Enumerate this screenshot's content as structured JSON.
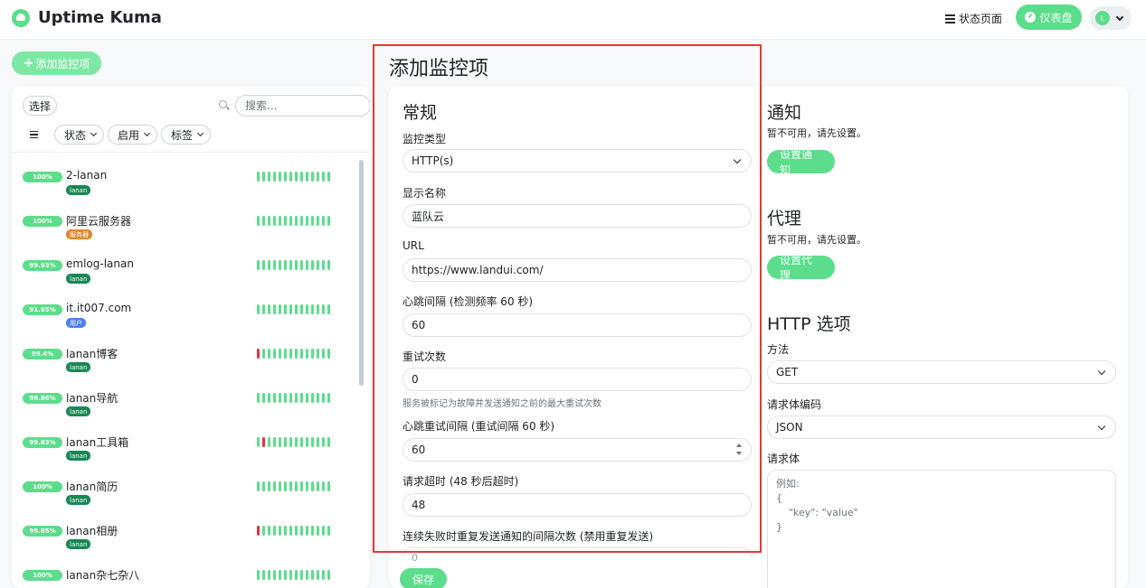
{
  "header": {
    "app_title": "Uptime Kuma",
    "status_page_label": "状态页面",
    "dashboard_label": "仪表盘",
    "avatar_letter": "L"
  },
  "sidebar": {
    "add_button_label": "添加监控项",
    "select_label": "选择",
    "search_placeholder": "搜索...",
    "filters": [
      "状态",
      "启用",
      "标签"
    ],
    "monitors": [
      {
        "uptime": "100%",
        "name": "2-lanan",
        "tag": "lanan",
        "tag_color": "#198754",
        "beats": "gggggggggggggg"
      },
      {
        "uptime": "100%",
        "name": "阿里云服务器",
        "tag": "服务器",
        "tag_color": "#e0862a",
        "beats": "gggggggggggggg"
      },
      {
        "uptime": "99.93%",
        "name": "emlog-lanan",
        "tag": "lanan",
        "tag_color": "#198754",
        "beats": "gggggggggggggg"
      },
      {
        "uptime": "91.65%",
        "name": "it.it007.com",
        "tag": "用户",
        "tag_color": "#4a7ff0",
        "beats": "gggggggggggggg"
      },
      {
        "uptime": "99.4%",
        "name": "lanan博客",
        "tag": "lanan",
        "tag_color": "#198754",
        "beats": "rggggggggggggg"
      },
      {
        "uptime": "99.86%",
        "name": "lanan导航",
        "tag": "lanan",
        "tag_color": "#198754",
        "beats": "gggggggggggggg"
      },
      {
        "uptime": "99.83%",
        "name": "lanan工具箱",
        "tag": "lanan",
        "tag_color": "#198754",
        "beats": "grgggggggggggg"
      },
      {
        "uptime": "100%",
        "name": "lanan简历",
        "tag": "lanan",
        "tag_color": "#198754",
        "beats": "gggggggggggggg"
      },
      {
        "uptime": "99.85%",
        "name": "lanan相册",
        "tag": "lanan",
        "tag_color": "#198754",
        "beats": "rggggggggggggg"
      },
      {
        "uptime": "100%",
        "name": "lanan杂七杂八",
        "tag": "",
        "tag_color": "#198754",
        "beats": "gggggggggggggg"
      }
    ],
    "beat_colors": {
      "up": "#5cdd8b",
      "down": "#dc3545"
    }
  },
  "form": {
    "page_title": "添加监控项",
    "general_title": "常规",
    "monitor_type_label": "监控类型",
    "monitor_type_value": "HTTP(s)",
    "friendly_name_label": "显示名称",
    "friendly_name_value": "蓝队云",
    "url_label": "URL",
    "url_value": "https://www.landui.com/",
    "interval_label": "心跳间隔 (检测频率 60 秒)",
    "interval_value": "60",
    "retries_label": "重试次数",
    "retries_value": "0",
    "retries_help": "服务被标记为故障并发送通知之前的最大重试次数",
    "retry_interval_label": "心跳重试间隔 (重试间隔 60 秒)",
    "retry_interval_value": "60",
    "timeout_label": "请求超时 (48 秒后超时)",
    "timeout_value": "48",
    "resend_label": "连续失败时重复发送通知的间隔次数 (禁用重复发送)",
    "resend_value": "0",
    "save_label": "保存"
  },
  "notifications": {
    "title": "通知",
    "empty_text": "暂不可用，请先设置。",
    "setup_label": "设置通知"
  },
  "proxy": {
    "title": "代理",
    "empty_text": "暂不可用，请先设置。",
    "setup_label": "设置代理"
  },
  "http_options": {
    "title": "HTTP 选项",
    "method_label": "方法",
    "method_value": "GET",
    "body_encoding_label": "请求体编码",
    "body_encoding_value": "JSON",
    "body_label": "请求体",
    "body_placeholder": "例如:\n{\n    \"key\": \"value\"\n}"
  },
  "accent_color": "#5cdd8b",
  "highlight_color": "#e53935"
}
